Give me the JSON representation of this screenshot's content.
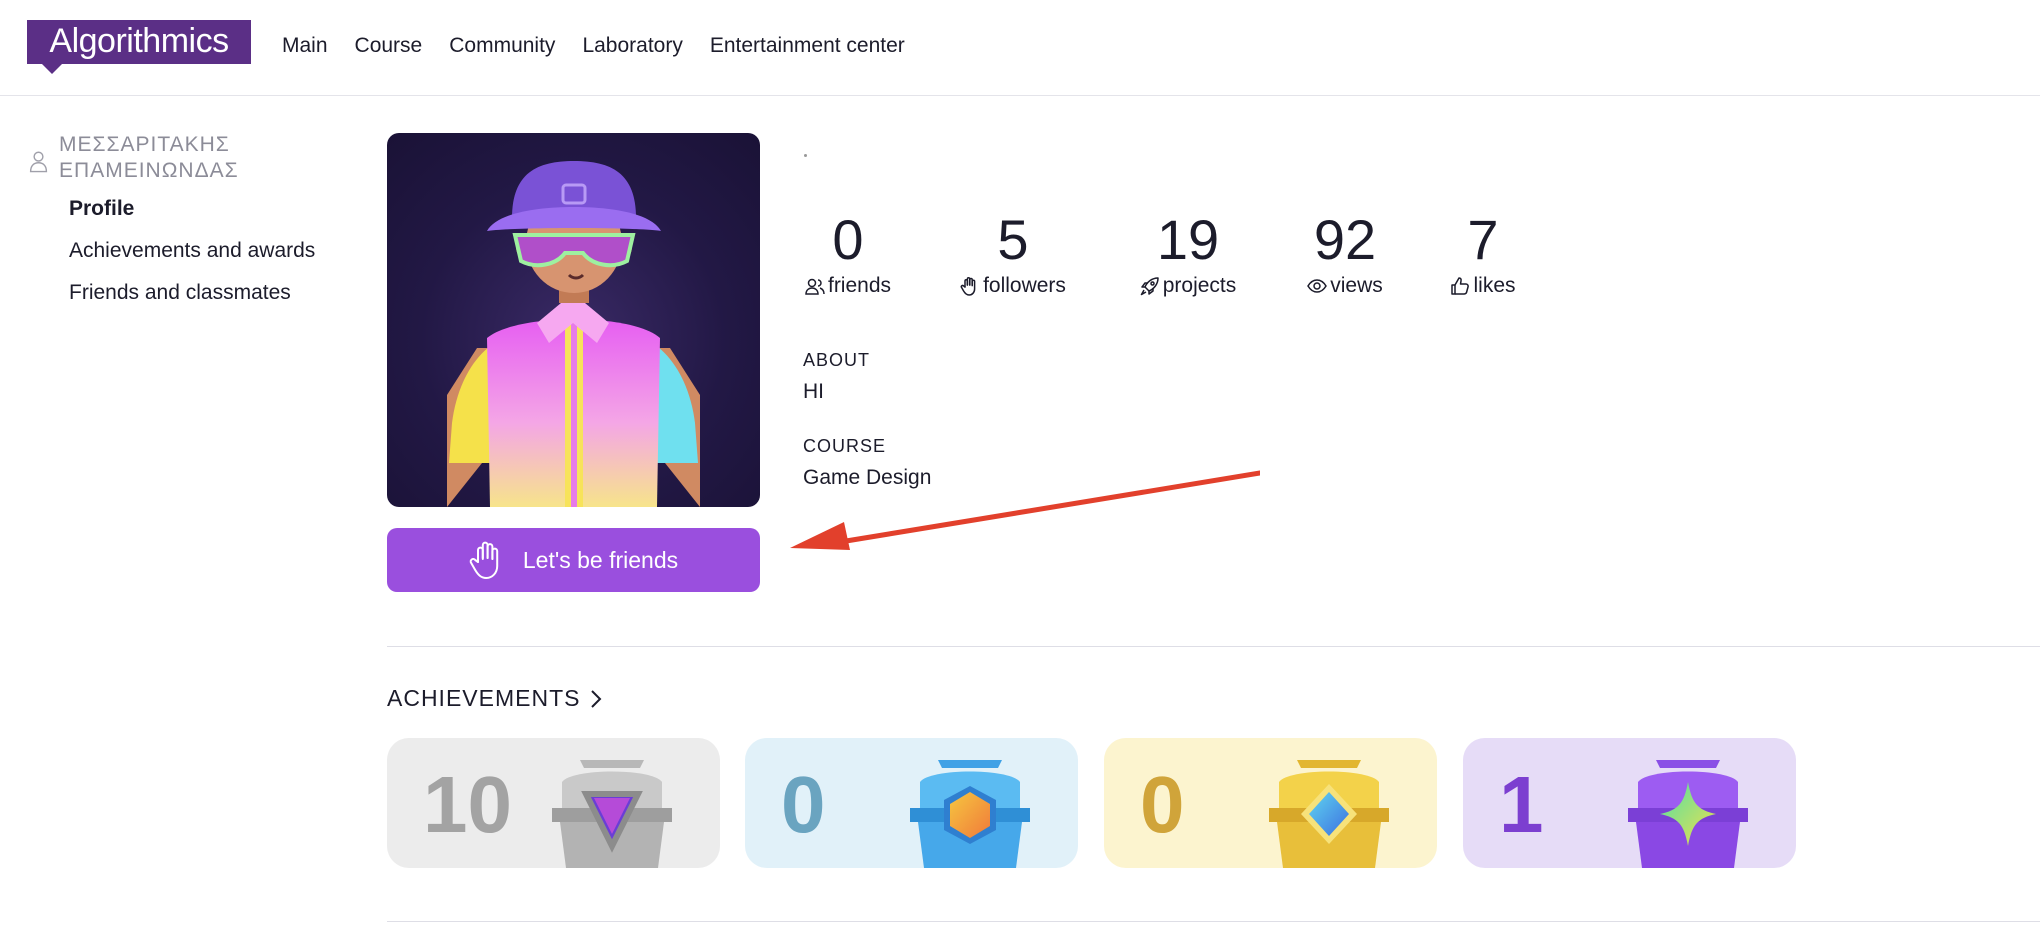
{
  "header": {
    "logo": "Algorithmics",
    "nav": [
      "Main",
      "Course",
      "Community",
      "Laboratory",
      "Entertainment center"
    ]
  },
  "sidebar": {
    "user_name": "ΜΕΣΣΑΡΙΤΑΚΗΣ ΕΠΑΜΕΙΝΩΝΔΑΣ",
    "links": [
      {
        "label": "Profile",
        "active": true
      },
      {
        "label": "Achievements and awards",
        "active": false
      },
      {
        "label": "Friends and classmates",
        "active": false
      }
    ]
  },
  "profile": {
    "friend_button": "Let's be friends",
    "stats": [
      {
        "value": "0",
        "label": "friends",
        "icon": "friends-icon"
      },
      {
        "value": "5",
        "label": "followers",
        "icon": "hand-icon"
      },
      {
        "value": "19",
        "label": "projects",
        "icon": "rocket-icon"
      },
      {
        "value": "92",
        "label": "views",
        "icon": "eye-icon"
      },
      {
        "value": "7",
        "label": "likes",
        "icon": "thumbs-up-icon"
      }
    ],
    "about_label": "ABOUT",
    "about_value": "HI",
    "course_label": "COURSE",
    "course_value": "Game Design"
  },
  "achievements": {
    "title": "ACHIEVEMENTS",
    "cards": [
      {
        "count": "10",
        "tier": "silver",
        "bg": "#ececec",
        "num_color": "#a3a3a3"
      },
      {
        "count": "0",
        "tier": "blue",
        "bg": "#e1f1f9",
        "num_color": "#6aa4c0"
      },
      {
        "count": "0",
        "tier": "gold",
        "bg": "#fcf4cf",
        "num_color": "#d0a43a"
      },
      {
        "count": "1",
        "tier": "purple",
        "bg": "#e6dcf7",
        "num_color": "#7c3fd0"
      }
    ]
  },
  "colors": {
    "brand": "#5b2f86",
    "button": "#9a4fde",
    "annotation_arrow": "#e2402c"
  }
}
